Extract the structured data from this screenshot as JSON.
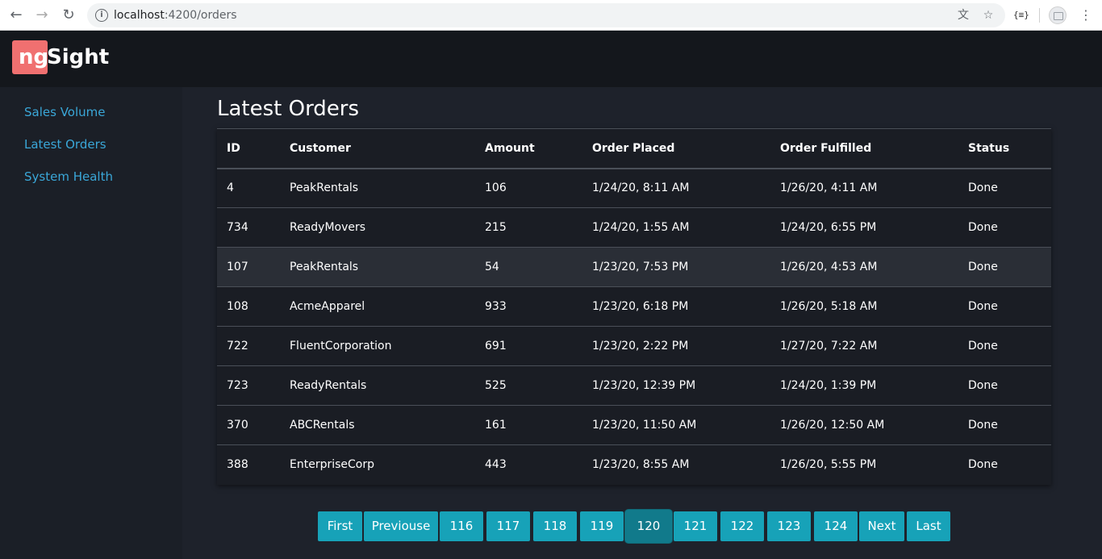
{
  "browser": {
    "url_host": "localhost",
    "url_rest": ":4200/orders",
    "icons": [
      "back-arrow-icon",
      "forward-arrow-icon",
      "reload-icon",
      "info-icon",
      "translate-icon",
      "star-icon",
      "extension-icon",
      "profile-icon",
      "menu-icon"
    ],
    "extension_label": "{≡}"
  },
  "header": {
    "logo_ng": "ng",
    "logo_sight": "Sight",
    "logo_accent_color": "#f07070"
  },
  "sidebar": {
    "items": [
      {
        "label": "Sales Volume"
      },
      {
        "label": "Latest Orders"
      },
      {
        "label": "System Health"
      }
    ],
    "link_color": "#3aa7d8"
  },
  "main": {
    "title": "Latest Orders",
    "table": {
      "columns": [
        "ID",
        "Customer",
        "Amount",
        "Order Placed",
        "Order Fulfilled",
        "Status"
      ],
      "rows": [
        [
          "4",
          "PeakRentals",
          "106",
          "1/24/20, 8:11 AM",
          "1/26/20, 4:11 AM",
          "Done"
        ],
        [
          "734",
          "ReadyMovers",
          "215",
          "1/24/20, 1:55 AM",
          "1/24/20, 6:55 PM",
          "Done"
        ],
        [
          "107",
          "PeakRentals",
          "54",
          "1/23/20, 7:53 PM",
          "1/26/20, 4:53 AM",
          "Done"
        ],
        [
          "108",
          "AcmeApparel",
          "933",
          "1/23/20, 6:18 PM",
          "1/26/20, 5:18 AM",
          "Done"
        ],
        [
          "722",
          "FluentCorporation",
          "691",
          "1/23/20, 2:22 PM",
          "1/27/20, 7:22 AM",
          "Done"
        ],
        [
          "723",
          "ReadyRentals",
          "525",
          "1/23/20, 12:39 PM",
          "1/24/20, 1:39 PM",
          "Done"
        ],
        [
          "370",
          "ABCRentals",
          "161",
          "1/23/20, 11:50 AM",
          "1/26/20, 12:50 AM",
          "Done"
        ],
        [
          "388",
          "EnterpriseCorp",
          "443",
          "1/23/20, 8:55 AM",
          "1/26/20, 5:55 PM",
          "Done"
        ]
      ]
    },
    "pagination": {
      "first": "First",
      "previous": "Previouse",
      "pages": [
        "116",
        "117",
        "118",
        "119",
        "120",
        "121",
        "122",
        "123",
        "124"
      ],
      "current": "120",
      "next": "Next",
      "last": "Last",
      "button_color": "#17a2b8",
      "active_color": "#117a8b"
    }
  }
}
